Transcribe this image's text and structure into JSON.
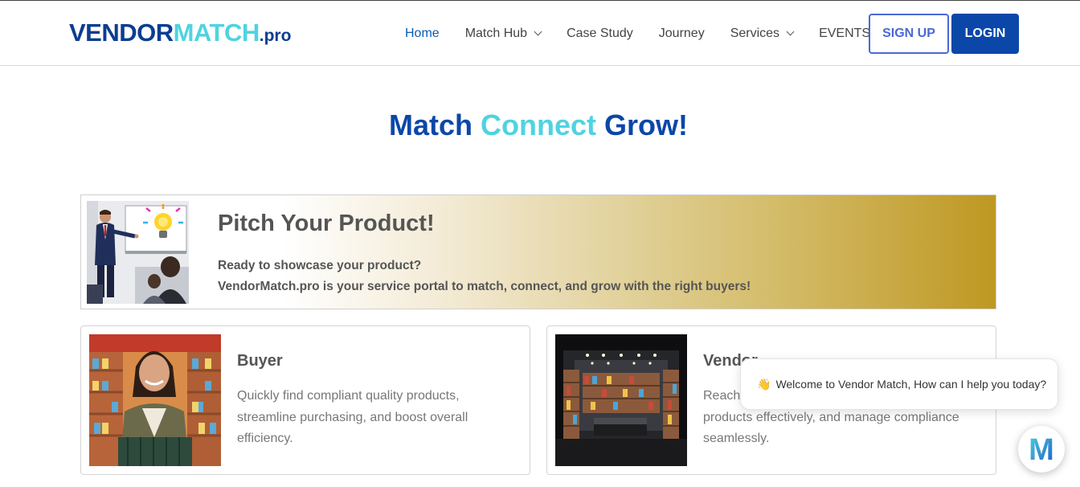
{
  "brand": {
    "logo_main_1": "VENDOR",
    "logo_main_2": "MATCH",
    "logo_suffix": ".pro",
    "colors": {
      "navy": "#0b3d91",
      "cyan": "#4fd3e0",
      "button_blue": "#0b47a8",
      "signup_blue": "#4a68d8",
      "gold": "#bf9822"
    }
  },
  "nav": {
    "home": "Home",
    "match_hub": "Match Hub",
    "case_study": "Case Study",
    "journey": "Journey",
    "services": "Services",
    "events": "EVENTS",
    "signup": "SIGN UP",
    "login": "LOGIN"
  },
  "hero": {
    "word1": "Match",
    "word2": "Connect",
    "word3": "Grow!"
  },
  "pitch": {
    "title": "Pitch Your Product!",
    "line1": "Ready to showcase your product?",
    "line2": "VendorMatch.pro is your service portal to match, connect, and grow with the right buyers!",
    "image_icon": "presenter-lightbulb-image"
  },
  "cards": [
    {
      "title": "Buyer",
      "description": "Quickly find compliant quality products, streamline purchasing, and boost overall efficiency.",
      "image_icon": "shopper-image"
    },
    {
      "title": "Vendor",
      "description": "Reach the right buyers, showcase your products effectively, and manage compliance seamlessly.",
      "image_icon": "store-shelves-image"
    }
  ],
  "chat": {
    "greeting": "Welcome to Vendor Match, How can I help you today?",
    "greeting_icon": "waving-hand-icon",
    "launcher_letter": "M"
  }
}
